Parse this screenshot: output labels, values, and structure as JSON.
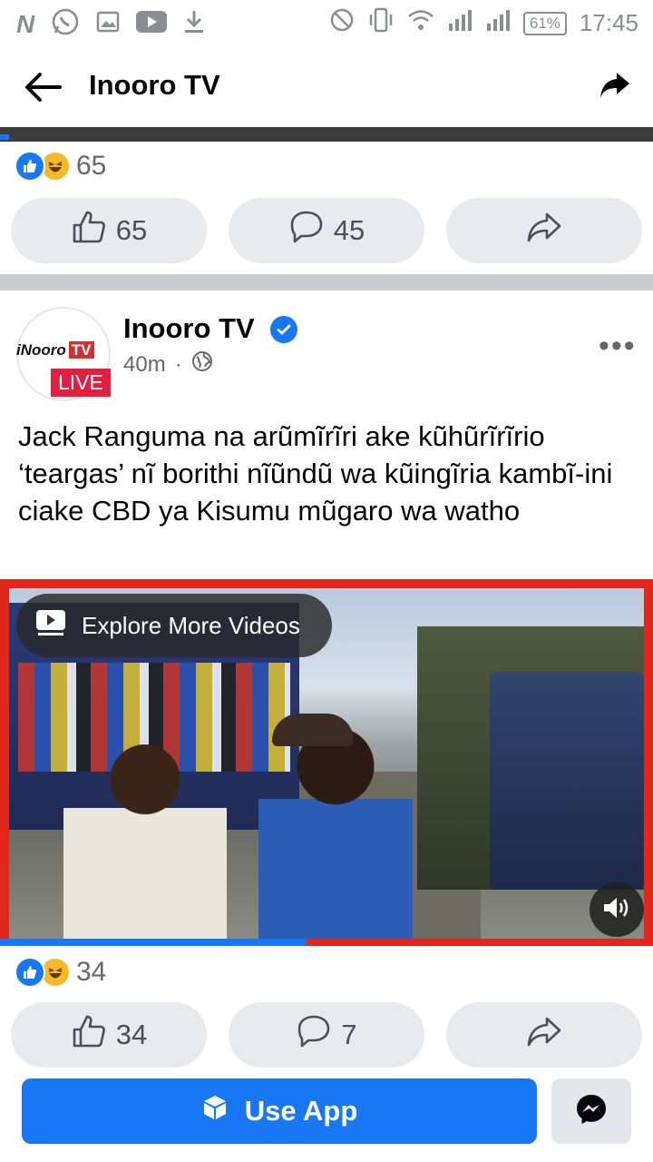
{
  "status_bar": {
    "time": "17:45",
    "battery": "61%",
    "icons": [
      "notification-n-icon",
      "whatsapp-icon",
      "gallery-icon",
      "youtube-icon",
      "download-icon",
      "dnd-icon",
      "vibrate-icon",
      "wifi-icon",
      "signal-icon",
      "signal-icon"
    ]
  },
  "header": {
    "title": "Inooro TV"
  },
  "prev_post": {
    "reaction_count": "65",
    "like_count": "65",
    "comment_count": "45"
  },
  "post": {
    "page_name": "Inooro TV",
    "avatar_logo_text": "iNooro",
    "avatar_logo_tv": "TV",
    "live_label": "LIVE",
    "time": "40m",
    "separator": "·",
    "more": "•••",
    "text": "Jack Ranguma na arũmĩrĩri ake kũhũrĩrĩrio ‘teargas’ nĩ borithi nĩũndũ wa kũingĩria kambĩ-ini ciake CBD ya Kisumu mũgaro wa watho",
    "video": {
      "explore_label": "Explore More Videos",
      "progress": 0.47
    },
    "reaction_count": "34",
    "like_count": "34",
    "comment_count": "7"
  },
  "bottom": {
    "use_app_label": "Use App"
  },
  "colors": {
    "accent": "#1877f2",
    "live": "#e41e3f",
    "video_border": "#e1261c"
  }
}
